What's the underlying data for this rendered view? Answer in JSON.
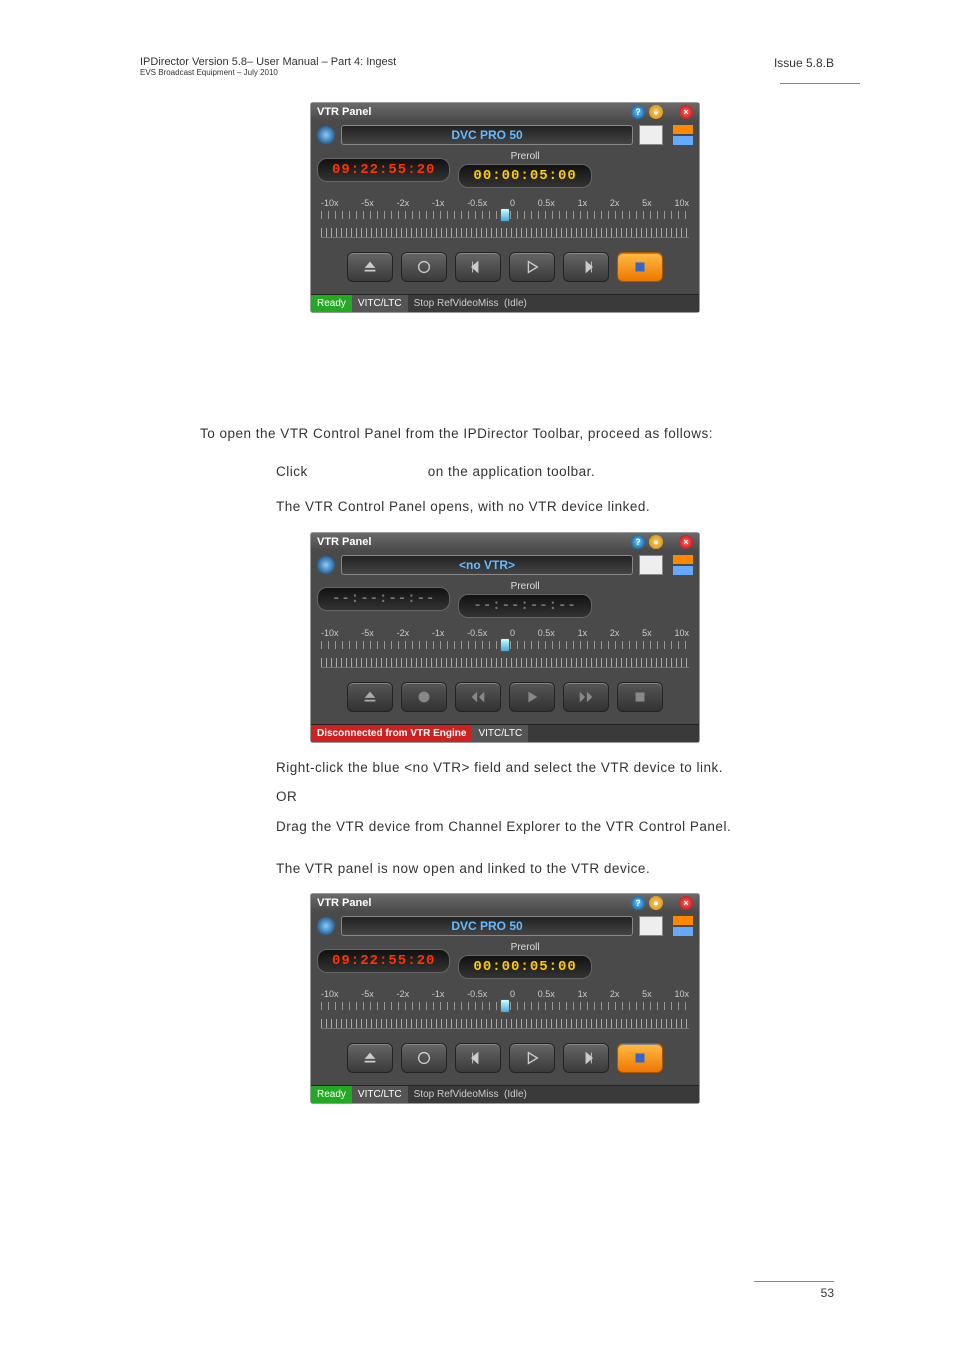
{
  "header": {
    "left_line1": "IPDirector Version 5.8– User Manual – Part 4: Ingest",
    "left_line2": "EVS Broadcast Equipment – July 2010",
    "right": "Issue 5.8.B"
  },
  "para_intro": "To open the VTR Control Panel from the IPDirector Toolbar, proceed as follows:",
  "step1_a": "Click",
  "step1_b": "on the application toolbar.",
  "step1_result": "The VTR Control Panel opens, with no VTR device linked.",
  "step2_a": "Right-click the blue <no VTR> field and select the VTR device to link.",
  "step2_or": "OR",
  "step2_b": "Drag the VTR device from Channel Explorer to the VTR Control Panel.",
  "step2_result": "The VTR panel is now open and linked to the VTR device.",
  "page_number": "53",
  "panel_linked": {
    "title": "VTR Panel",
    "device": "DVC PRO 50",
    "timecode": "09:22:55:20",
    "preroll_label": "Preroll",
    "preroll_value": "00:00:05:00",
    "speeds": [
      "-10x",
      "-5x",
      "-2x",
      "-1x",
      "-0.5x",
      "0",
      "0.5x",
      "1x",
      "2x",
      "5x",
      "10x"
    ],
    "status": {
      "ready": "Ready",
      "vitc": "VITC/LTC",
      "msg": "Stop RefVideoMiss",
      "idle": "(Idle)"
    }
  },
  "panel_novtr": {
    "title": "VTR Panel",
    "device": "<no VTR>",
    "timecode": "--:--:--:--",
    "preroll_label": "Preroll",
    "preroll_value": "--:--:--:--",
    "speeds": [
      "-10x",
      "-5x",
      "-2x",
      "-1x",
      "-0.5x",
      "0",
      "0.5x",
      "1x",
      "2x",
      "5x",
      "10x"
    ],
    "status": {
      "disc": "Disconnected from VTR Engine",
      "vitc": "VITC/LTC"
    }
  }
}
